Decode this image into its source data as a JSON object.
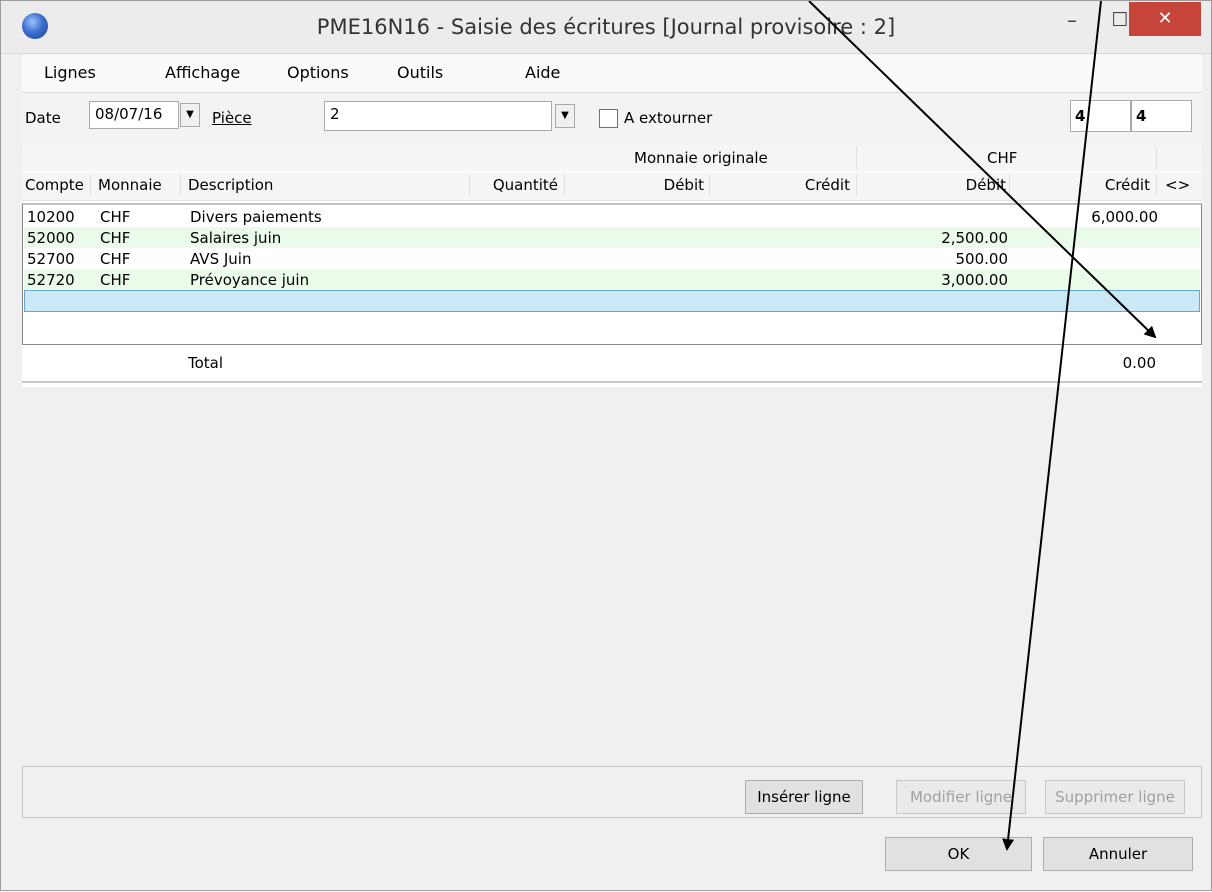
{
  "window": {
    "title": "PME16N16 - Saisie des écritures [Journal provisoire : 2]",
    "minimize_symbol": "–",
    "maximize_symbol": "☐",
    "close_symbol": "✕"
  },
  "menu": {
    "items": [
      "Lignes",
      "Affichage",
      "Options",
      "Outils",
      "Aide"
    ]
  },
  "toolbar": {
    "date_label": "Date",
    "date_value": "08/07/16",
    "piece_label": "Pièce",
    "piece_value": "2",
    "reverse_label": "A extourner",
    "reverse_checked": false,
    "counter1": "4",
    "counter2": "4"
  },
  "table": {
    "group_headers": {
      "original": "Monnaie originale",
      "chf": "CHF"
    },
    "columns": [
      "Compte",
      "Monnaie",
      "Description",
      "Quantité",
      "Débit",
      "Crédit",
      "Débit",
      "Crédit",
      "<>"
    ],
    "rows": [
      {
        "compte": "10200",
        "monnaie": "CHF",
        "description": "Divers paiements",
        "chf_debit": "",
        "chf_credit": "6,000.00"
      },
      {
        "compte": "52000",
        "monnaie": "CHF",
        "description": "Salaires juin",
        "chf_debit": "2,500.00",
        "chf_credit": ""
      },
      {
        "compte": "52700",
        "monnaie": "CHF",
        "description": "AVS Juin",
        "chf_debit": "500.00",
        "chf_credit": ""
      },
      {
        "compte": "52720",
        "monnaie": "CHF",
        "description": "Prévoyance juin",
        "chf_debit": "3,000.00",
        "chf_credit": ""
      }
    ],
    "total_label": "Total",
    "total_value": "0.00"
  },
  "buttons": {
    "insert": "Insérer ligne",
    "modify": "Modifier ligne",
    "delete": "Supprimer ligne",
    "ok": "OK",
    "cancel": "Annuler"
  },
  "colors": {
    "alt_row": "#eafbea",
    "selected_row": "#cbe8f7",
    "close_button": "#c7443b"
  }
}
